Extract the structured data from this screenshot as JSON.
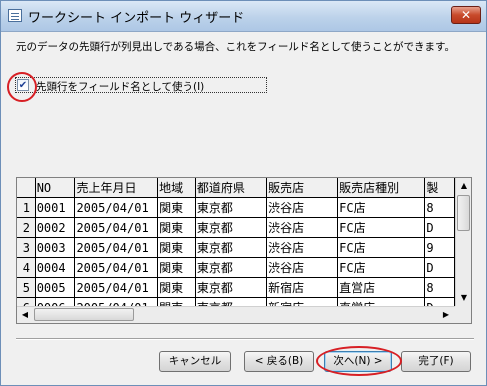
{
  "window": {
    "title": "ワークシート インポート ウィザード",
    "close_symbol": "✕"
  },
  "description": "元のデータの先頭行が列見出しである場合、これをフィールド名として使うことができます。",
  "checkbox": {
    "label": "先頭行をフィールド名として使う(I)",
    "checked": true,
    "check_mark": "✔"
  },
  "grid": {
    "headers": [
      "NO",
      "売上年月日",
      "地域",
      "都道府県",
      "販売店",
      "販売店種別",
      "製"
    ],
    "row_numbers": [
      "1",
      "2",
      "3",
      "4",
      "5",
      "6"
    ],
    "rows": [
      [
        "0001",
        "2005/04/01",
        "関東",
        "東京都",
        "渋谷店",
        "FC店",
        "8"
      ],
      [
        "0002",
        "2005/04/01",
        "関東",
        "東京都",
        "渋谷店",
        "FC店",
        "D"
      ],
      [
        "0003",
        "2005/04/01",
        "関東",
        "東京都",
        "渋谷店",
        "FC店",
        "9"
      ],
      [
        "0004",
        "2005/04/01",
        "関東",
        "東京都",
        "渋谷店",
        "FC店",
        "D"
      ],
      [
        "0005",
        "2005/04/01",
        "関東",
        "東京都",
        "新宿店",
        "直営店",
        "8"
      ],
      [
        "0006",
        "2005/04/01",
        "関東",
        "東京都",
        "新宿店",
        "直営店",
        "D"
      ]
    ]
  },
  "scrollbar_icons": {
    "up": "▲",
    "down": "▼",
    "left": "◀",
    "right": "▶"
  },
  "buttons": {
    "cancel": "キャンセル",
    "back": "< 戻る(B)",
    "next": "次へ(N) >",
    "finish": "完了(F)"
  },
  "colors": {
    "highlight_circle": "#d71f24"
  }
}
